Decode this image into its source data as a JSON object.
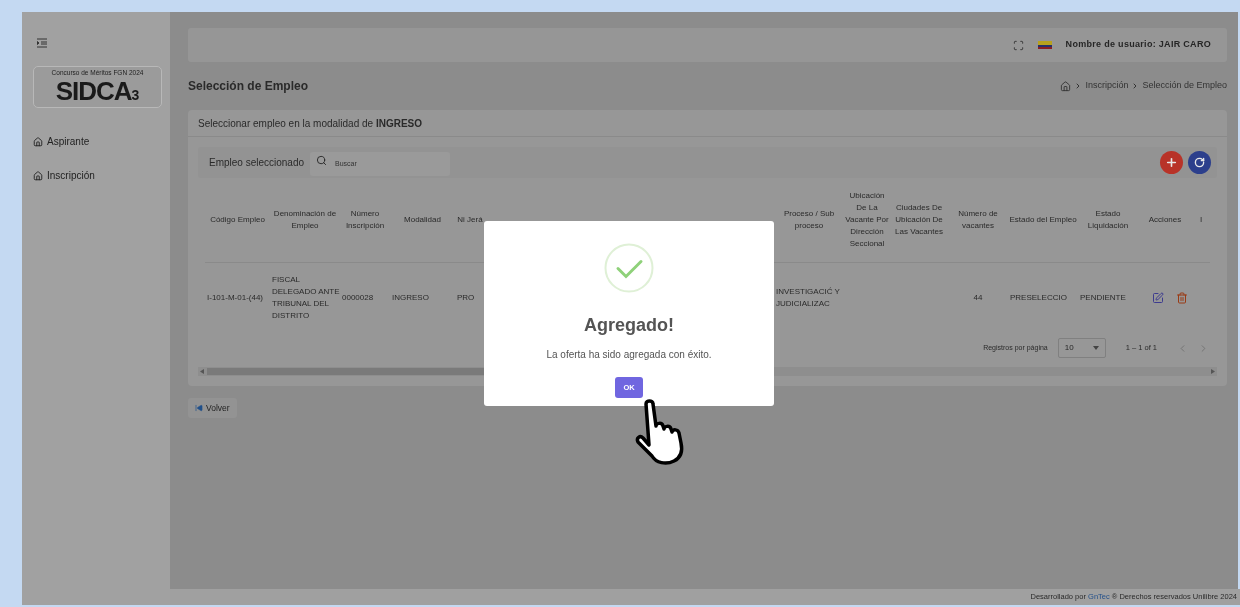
{
  "sidebar": {
    "logo": {
      "caption": "Concurso de Méritos FGN 2024",
      "wordmark": "SIDCA",
      "suffix": "3"
    },
    "items": [
      {
        "label": "Aspirante"
      },
      {
        "label": "Inscripción"
      }
    ]
  },
  "topbar": {
    "user": "Nombre de usuario: JAIR CARO"
  },
  "page": {
    "title": "Selección de Empleo",
    "breadcrumb": [
      "Inscripción",
      "Selección de Empleo"
    ]
  },
  "card": {
    "heading": "Seleccionar empleo en la modalidad de **INGRESO**",
    "toolbar": {
      "label": "Empleo seleccionado",
      "search_placeholder": "Buscar"
    },
    "table": {
      "columns": [
        "Código Empleo",
        "Denominación de Empleo",
        "Número Inscripción",
        "Modalidad",
        "Ni Jerá",
        "Proceso / Sub proceso",
        "Ubicación De La Vacante Por Dirección Seccional",
        "Ciudades De Ubicación De Las Vacantes",
        "Número de vacantes",
        "Estado del Empleo",
        "Estado Liquidación",
        "Acciones",
        "I"
      ],
      "rows": [
        [
          "I-101-M-01-(44)",
          "FISCAL DELEGADO ANTE TRIBUNAL DEL DISTRITO",
          "0000028",
          "INGRESO",
          "PRO",
          "INVESTIGACIĆ Y JUDICIALIZAC",
          "",
          "",
          "44",
          "PRESELECCIO",
          "PENDIENTE"
        ]
      ]
    },
    "pagination": {
      "label": "Registros por página",
      "per_page": "10",
      "range": "1 – 1 of 1",
      "prev_disabled": true,
      "next_disabled": true
    }
  },
  "back_button": "Volver",
  "footer": {
    "prefix": "Desarrollado por",
    "link": "GnTec",
    "suffix": "® Derechos reservados Unilibre 2024"
  },
  "dialog": {
    "title": "Agregado!",
    "message": "La oferta ha sido agregada con éxito.",
    "button": "OK"
  }
}
